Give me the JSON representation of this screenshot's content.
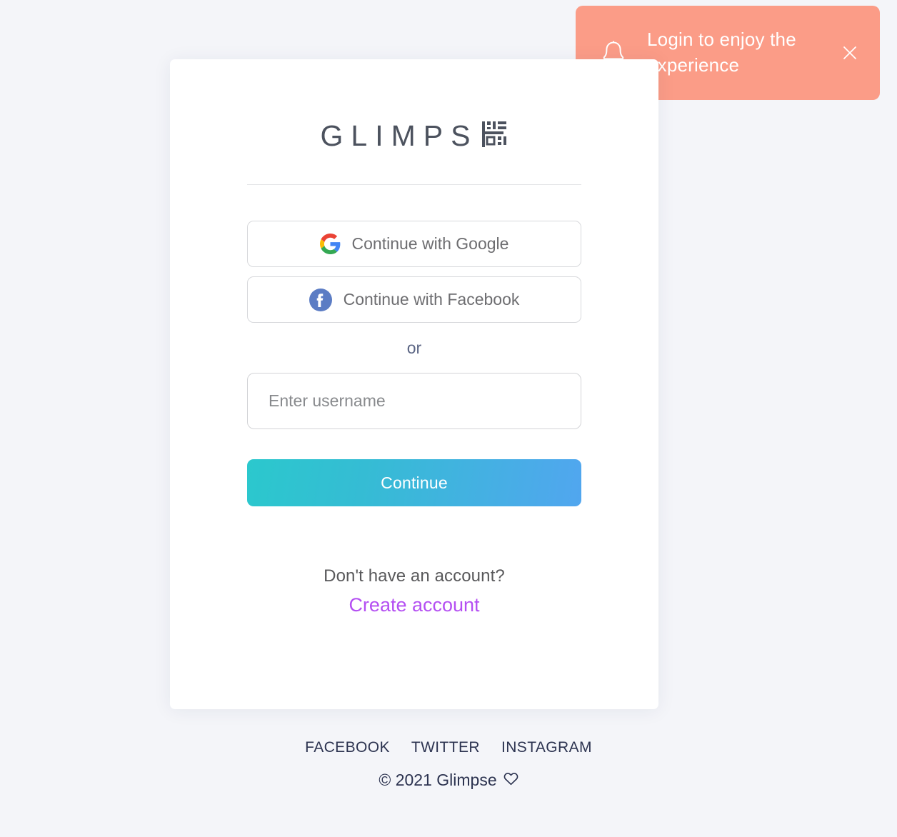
{
  "toast": {
    "message": "Login to enjoy the experience",
    "bell_icon": "bell-icon",
    "close_icon": "close-icon",
    "background_color": "#fb9c87",
    "text_color": "#ffffff"
  },
  "card": {
    "logo": {
      "text": "GLIMPS",
      "mark_icon": "qr-code-icon"
    },
    "social_buttons": [
      {
        "label": "Continue with Google",
        "icon": "google-icon"
      },
      {
        "label": "Continue with Facebook",
        "icon": "facebook-icon"
      }
    ],
    "divider_label": "or",
    "username": {
      "placeholder": "Enter username",
      "value": ""
    },
    "continue_label": "Continue",
    "signup": {
      "question": "Don't have an account?",
      "link_label": "Create account",
      "link_color": "#b44ff2"
    }
  },
  "footer": {
    "links": [
      "FACEBOOK",
      "TWITTER",
      "INSTAGRAM"
    ],
    "copyright": "© 2021 Glimpse",
    "heart_icon": "heart-icon"
  },
  "theme": {
    "page_background": "#f4f5f9",
    "card_background": "#ffffff",
    "gradient_start": "#2bc8cd",
    "gradient_end": "#51a6ef"
  }
}
